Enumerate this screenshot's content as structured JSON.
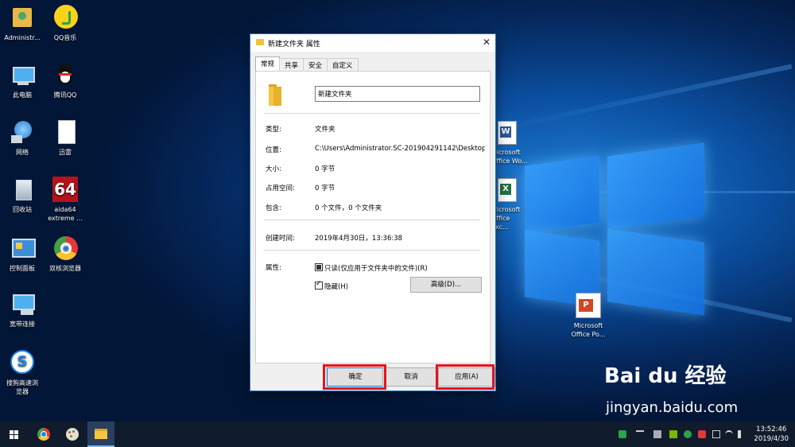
{
  "desktop": {
    "icons": [
      {
        "label": "Administr..."
      },
      {
        "label": "QQ音乐"
      },
      {
        "label": "此电脑"
      },
      {
        "label": "腾讯QQ"
      },
      {
        "label": "网络"
      },
      {
        "label": "迅雷"
      },
      {
        "label": "回收站"
      },
      {
        "label": "aida64\nextreme ..."
      },
      {
        "label": "控制面板"
      },
      {
        "label": "双核浏览器"
      },
      {
        "label": "宽带连接"
      },
      {
        "label": "搜狗高速浏\n览器"
      }
    ],
    "right_icons": [
      {
        "label": "Microsoft\nOffice Wo..."
      },
      {
        "label": "Microsoft\nOffice Exc..."
      },
      {
        "label": "Microsoft\nOffice Po..."
      }
    ],
    "aida_tile": "64"
  },
  "dialog": {
    "title": "新建文件夹 属性",
    "close": "✕",
    "tabs": [
      "常规",
      "共享",
      "安全",
      "自定义"
    ],
    "name_value": "新建文件夹",
    "rows": {
      "type_label": "类型:",
      "type_value": "文件夹",
      "location_label": "位置:",
      "location_value": "C:\\Users\\Administrator.SC-201904291142\\Desktop",
      "size_label": "大小:",
      "size_value": "0 字节",
      "disk_label": "占用空间:",
      "disk_value": "0 字节",
      "contains_label": "包含:",
      "contains_value": "0 个文件，0 个文件夹",
      "created_label": "创建时间:",
      "created_value": "2019年4月30日，13:36:38",
      "attributes_label": "属性:"
    },
    "readonly_label": "只读(仅应用于文件夹中的文件)(R)",
    "hidden_label": "隐藏(H)",
    "advanced_label": "高级(D)...",
    "ok_label": "确定",
    "cancel_label": "取消",
    "apply_label": "应用(A)"
  },
  "watermark": {
    "brand": "Bai du 经验",
    "url": "jingyan.baidu.com"
  },
  "taskbar": {
    "time": "13:52:46",
    "date": "2019/4/30"
  },
  "colors": {
    "accent": "#0078d7",
    "highlight": "#e3141f",
    "taskbar": "#101b2c"
  }
}
